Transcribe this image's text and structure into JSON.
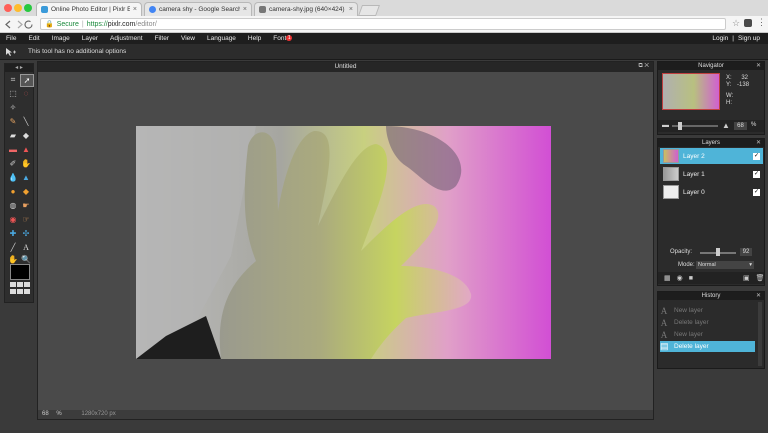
{
  "browser": {
    "tabs": [
      {
        "label": "Online Photo Editor | Pixlr Edi",
        "active": true,
        "favicon_color": "#3a9ad9"
      },
      {
        "label": "camera shy - Google Search",
        "active": false,
        "favicon_color": "#4285f4"
      },
      {
        "label": "camera-shy.jpg (640×424)",
        "active": false,
        "favicon_color": "#777777"
      }
    ],
    "close_glyph": "×",
    "url": {
      "secure_label": "Secure",
      "scheme": "https://",
      "host": "pixlr.com",
      "path": "/editor/"
    }
  },
  "menu": {
    "items": [
      "File",
      "Edit",
      "Image",
      "Layer",
      "Adjustment",
      "Filter",
      "View",
      "Language",
      "Help",
      "Font"
    ],
    "font_badge": "1",
    "login": "Login",
    "separator": "|",
    "signup": "Sign up"
  },
  "options_bar": {
    "message": "This tool has no additional options"
  },
  "canvas": {
    "title": "Untitled",
    "zoom": "68",
    "zoom_unit": "%",
    "size": "1280x720 px"
  },
  "navigator": {
    "title": "Navigator",
    "x_label": "X:",
    "x_value": "32",
    "y_label": "Y:",
    "y_value": "-138",
    "w_label": "W:",
    "h_label": "H:",
    "zoom": "68",
    "zoom_unit": "%"
  },
  "layers": {
    "title": "Layers",
    "items": [
      {
        "name": "Layer 2",
        "selected": true
      },
      {
        "name": "Layer 1",
        "selected": false
      },
      {
        "name": "Layer 0",
        "selected": false
      }
    ],
    "opacity_label": "Opacity:",
    "opacity_value": "92",
    "mode_label": "Mode:",
    "mode_value": "Normal"
  },
  "history": {
    "title": "History",
    "items": [
      {
        "label": "New layer",
        "selected": false
      },
      {
        "label": "Delete layer",
        "selected": false
      },
      {
        "label": "New layer",
        "selected": false
      },
      {
        "label": "Delete layer",
        "selected": true
      }
    ]
  },
  "colors": {
    "accent": "#4fb4d8",
    "app_bg": "#3a3a3a",
    "menubar": "#1e1e1e"
  }
}
